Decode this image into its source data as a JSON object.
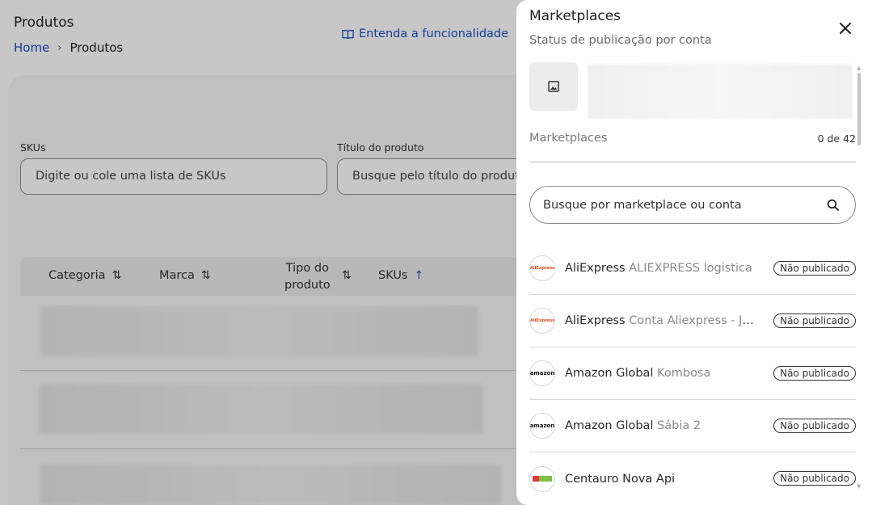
{
  "page": {
    "title": "Produtos",
    "breadcrumb": {
      "home": "Home",
      "separator": "›",
      "current": "Produtos"
    },
    "help_link": "Entenda a funcionalidade",
    "filters": {
      "skus_label": "SKUs",
      "skus_placeholder": "Digite ou cole uma lista de SKUs",
      "title_label": "Título do produto",
      "title_placeholder": "Busque pelo título do produt"
    },
    "table": {
      "headers": {
        "categoria": "Categoria",
        "marca": "Marca",
        "tipo_line1": "Tipo do",
        "tipo_line2": "produto",
        "skus": "SKUs"
      },
      "sort_icon": "⇅",
      "sort_active_icon": "↑"
    }
  },
  "drawer": {
    "title": "Marketplaces",
    "subtitle": "Status de publicação por conta",
    "marketplaces_label": "Marketplaces",
    "count": "0 de 42",
    "search_placeholder": "Busque por marketplace ou conta",
    "items": [
      {
        "name": "AliExpress",
        "account": "ALIEXPRESS logistica",
        "status": "Não publicado",
        "logo": "aliexpress-logo",
        "logo_text": "AliExpress"
      },
      {
        "name": "AliExpress",
        "account": "Conta Aliexpress - Joao Pedro",
        "status": "Não publicado",
        "logo": "aliexpress-logo",
        "logo_text": "AliExpress"
      },
      {
        "name": "Amazon Global",
        "account": "Kombosa",
        "status": "Não publicado",
        "logo": "amazon-logo",
        "logo_text": "amazon"
      },
      {
        "name": "Amazon Global",
        "account": "Sábia 2",
        "status": "Não publicado",
        "logo": "amazon-logo",
        "logo_text": "amazon"
      },
      {
        "name": "Centauro Nova Api",
        "account": "",
        "status": "Não publicado",
        "logo": "centauro-logo",
        "logo_text": ""
      }
    ]
  },
  "colors": {
    "link": "#1a4fc4",
    "overlay": "rgba(0,0,0,0.22)",
    "badge_border": "#333333"
  }
}
